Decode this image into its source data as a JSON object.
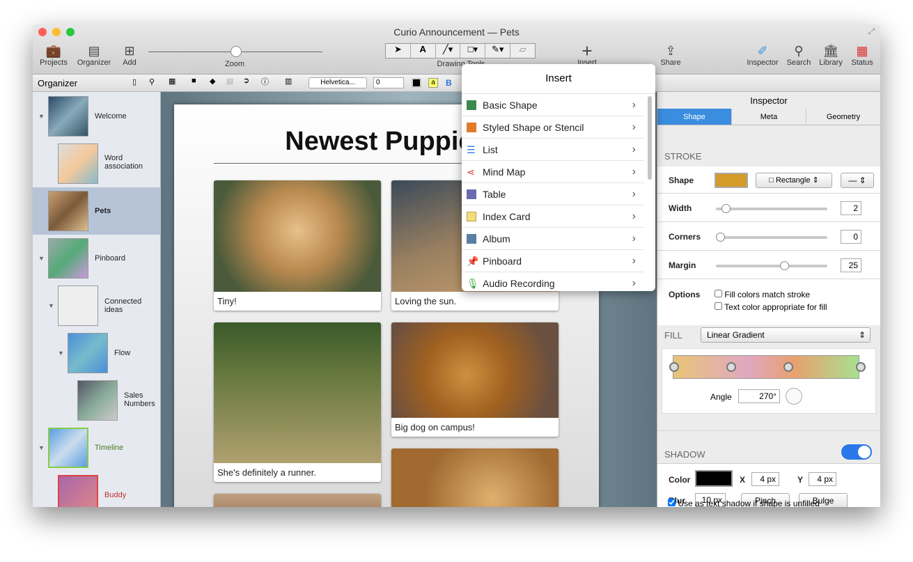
{
  "window": {
    "title": "Curio Announcement — Pets"
  },
  "toolbar": {
    "projects": "Projects",
    "organizer": "Organizer",
    "add": "Add",
    "zoom": "Zoom",
    "drawing_tools": "Drawing Tools",
    "insert": "Insert",
    "share": "Share",
    "inspector": "Inspector",
    "search": "Search",
    "library": "Library",
    "status": "Status"
  },
  "formatbar": {
    "font": "Helvetica...",
    "size": "0",
    "bold": "B",
    "text_highlight": "a"
  },
  "sidebar": {
    "title": "Organizer",
    "items": [
      {
        "label": "Welcome"
      },
      {
        "label": "Word association"
      },
      {
        "label": "Pets"
      },
      {
        "label": "Pinboard"
      },
      {
        "label": "Connected ideas"
      },
      {
        "label": "Flow"
      },
      {
        "label": "Sales Numbers"
      },
      {
        "label": "Timeline"
      },
      {
        "label": "Buddy"
      }
    ]
  },
  "canvas": {
    "heading": "Newest Puppies",
    "cards": [
      {
        "caption": "Tiny!"
      },
      {
        "caption": "Loving the sun."
      },
      {
        "caption": "She's definitely a runner."
      },
      {
        "caption": "Big dog on campus!"
      }
    ]
  },
  "insert_menu": {
    "title": "Insert",
    "items": [
      {
        "label": "Basic Shape",
        "color": "#3a8a4a"
      },
      {
        "label": "Styled Shape or Stencil",
        "color": "#e07b2a"
      },
      {
        "label": "List",
        "color": "#2a7de1"
      },
      {
        "label": "Mind Map",
        "color": "#d0452a"
      },
      {
        "label": "Table",
        "color": "#6b6bb0"
      },
      {
        "label": "Index Card",
        "color": "#d6b640"
      },
      {
        "label": "Album",
        "color": "#5a7fa0"
      },
      {
        "label": "Pinboard",
        "color": "#9b59d0"
      },
      {
        "label": "Audio Recording",
        "color": "#3aa03a"
      }
    ]
  },
  "inspector": {
    "title": "Inspector",
    "tabs": [
      "Shape",
      "Meta",
      "Geometry"
    ],
    "active_tab": "Shape",
    "stroke": {
      "heading": "STROKE",
      "shape_label": "Shape",
      "stroke_color": "#d49a2a",
      "shape_type": "Rectangle",
      "width_label": "Width",
      "width": "2",
      "width_fraction": 0.1,
      "corners_label": "Corners",
      "corners": "0",
      "corners_fraction": 0,
      "margin_label": "Margin",
      "margin": "25",
      "margin_fraction": 0.62,
      "options_label": "Options",
      "opt1": "Fill colors match stroke",
      "opt2": "Text color appropriate for fill",
      "opt1_checked": false,
      "opt2_checked": false
    },
    "fill": {
      "heading": "FILL",
      "type": "Linear Gradient",
      "angle_label": "Angle",
      "angle": "270°"
    },
    "shadow": {
      "heading": "SHADOW",
      "enabled": true,
      "color_label": "Color",
      "x_label": "X",
      "x": "4 px",
      "y_label": "Y",
      "y": "4 px",
      "blur_label": "Blur",
      "blur": "10 px",
      "pinch": "Pinch",
      "bulge": "Bulge",
      "text_shadow": "Use as text shadow if shape is unfilled",
      "text_shadow_checked": true
    }
  }
}
